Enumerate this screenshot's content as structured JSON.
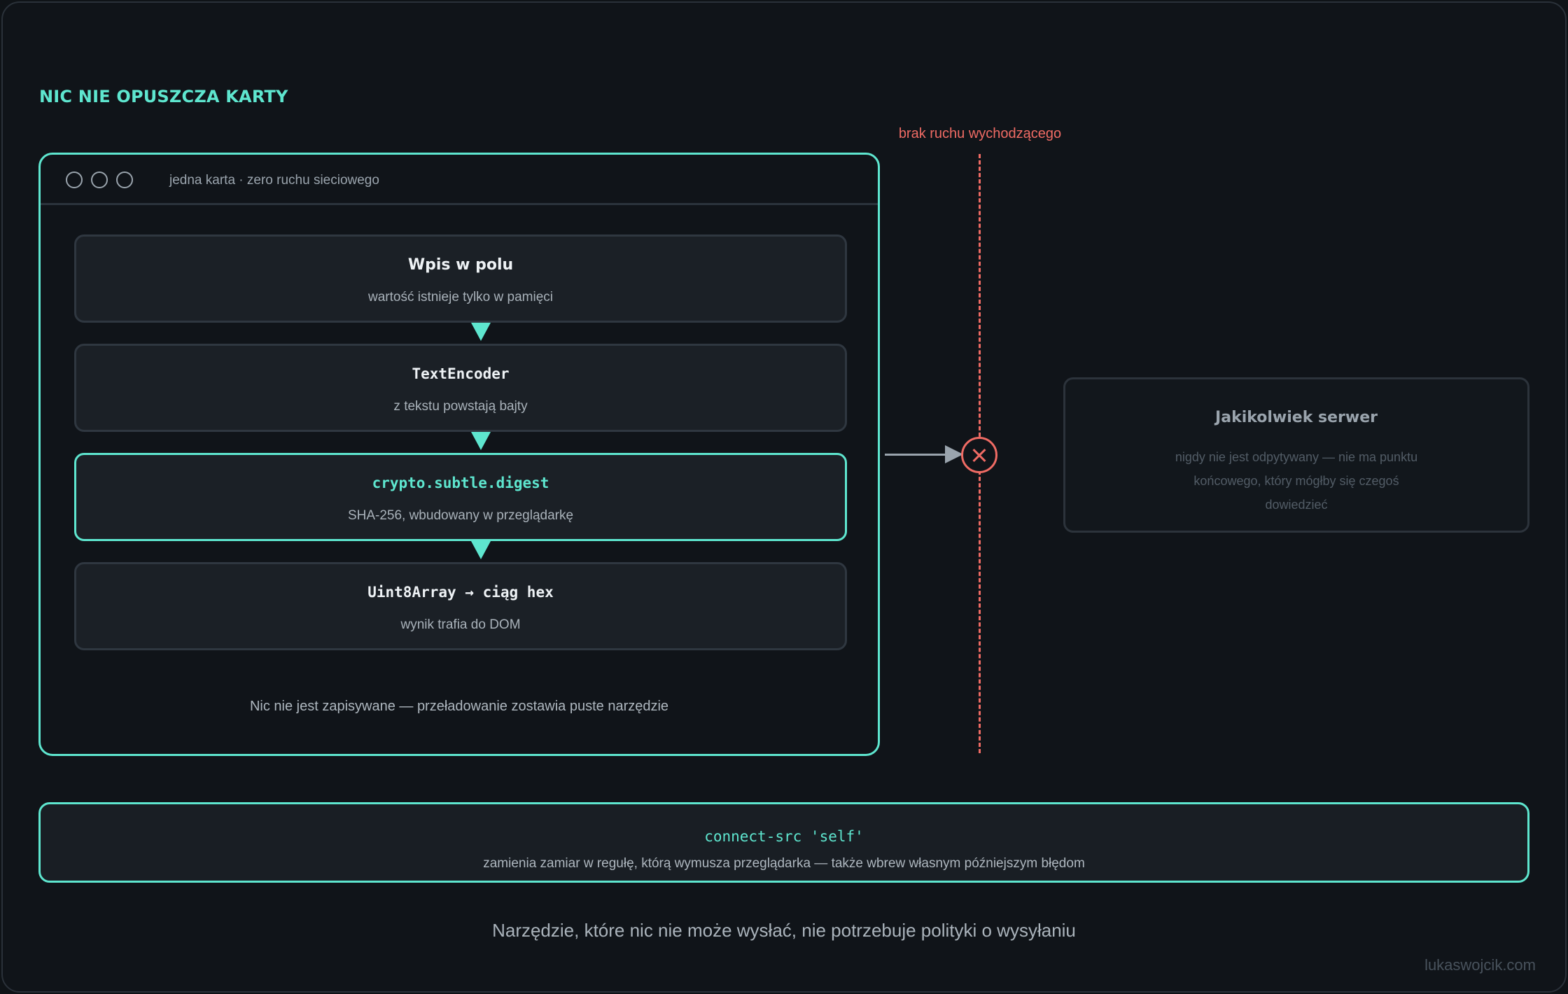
{
  "title": "NIC NIE OPUSZCZA KARTY",
  "tab": {
    "caption": "jedna karta · zero ruchu sieciowego",
    "steps": [
      {
        "title": "Wpis w polu",
        "subtitle": "wartość istnieje tylko w pamięci"
      },
      {
        "title": "TextEncoder",
        "subtitle": "z tekstu powstają bajty"
      },
      {
        "title": "crypto.subtle.digest",
        "subtitle": "SHA-256, wbudowany w przeglądarkę"
      },
      {
        "title": "Uint8Array → ciąg hex",
        "subtitle": "wynik trafia do DOM"
      }
    ],
    "footer": "Nic nie jest zapisywane — przeładowanie zostawia puste narzędzie"
  },
  "barrier": {
    "label": "brak ruchu wychodzącego"
  },
  "server": {
    "title": "Jakikolwiek serwer",
    "subtitle": "nigdy nie jest odpytywany — nie ma punktu końcowego, który mógłby się czegoś dowiedzieć"
  },
  "policy": {
    "code": "connect-src 'self'",
    "subtitle": "zamienia zamiar w regułę, którą wymusza przeglądarka — także wbrew własnym późniejszym błędom"
  },
  "tagline": "Narzędzie, które nic nie może wysłać, nie potrzebuje polityki o wysyłaniu",
  "credit": "lukaswojcik.com",
  "colors": {
    "accent": "#5ee6cf",
    "barrier": "#ef6b64",
    "background": "#101419"
  }
}
